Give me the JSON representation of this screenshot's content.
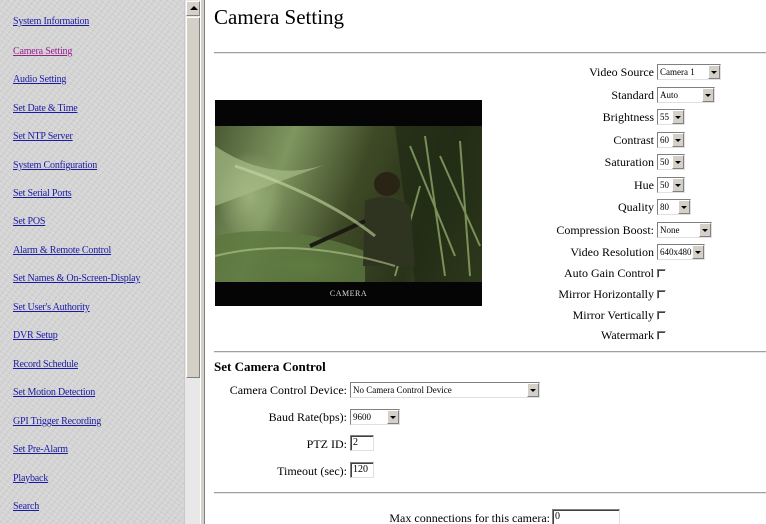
{
  "nav": {
    "items": [
      {
        "label": "System Information",
        "active": false
      },
      {
        "label": "Camera Setting",
        "active": true
      },
      {
        "label": "Audio Setting",
        "active": false
      },
      {
        "label": "Set Date & Time",
        "active": false
      },
      {
        "label": "Set NTP Server",
        "active": false
      },
      {
        "label": "System Configuration",
        "active": false
      },
      {
        "label": "Set Serial Ports",
        "active": false
      },
      {
        "label": "Set POS",
        "active": false
      },
      {
        "label": "Alarm & Remote Control",
        "active": false
      },
      {
        "label": "Set Names & On-Screen-Display",
        "active": false
      },
      {
        "label": "Set User's Authority",
        "active": false
      },
      {
        "label": "DVR Setup",
        "active": false
      },
      {
        "label": "Record Schedule",
        "active": false
      },
      {
        "label": "Set Motion Detection",
        "active": false
      },
      {
        "label": "GPI Trigger Recording",
        "active": false
      },
      {
        "label": "Set Pre-Alarm",
        "active": false
      },
      {
        "label": "Playback",
        "active": false
      },
      {
        "label": "Search",
        "active": false
      }
    ],
    "link_color": "#1a1aa6",
    "active_color": "#9a1f8f"
  },
  "page": {
    "title": "Camera Setting"
  },
  "preview": {
    "caption": "CAMERA"
  },
  "camera": {
    "video_source": {
      "label": "Video Source",
      "value": "Camera 1"
    },
    "standard": {
      "label": "Standard",
      "value": "Auto"
    },
    "brightness": {
      "label": "Brightness",
      "value": "55"
    },
    "contrast": {
      "label": "Contrast",
      "value": "60"
    },
    "saturation": {
      "label": "Saturation",
      "value": "50"
    },
    "hue": {
      "label": "Hue",
      "value": "50"
    },
    "quality": {
      "label": "Quality",
      "value": "80"
    },
    "compression_boost": {
      "label": "Compression Boost:",
      "value": "None"
    },
    "video_resolution": {
      "label": "Video Resolution",
      "value": "640x480"
    },
    "auto_gain_control": {
      "label": "Auto Gain Control",
      "checked": false
    },
    "mirror_horizontally": {
      "label": "Mirror Horizontally",
      "checked": false
    },
    "mirror_vertically": {
      "label": "Mirror Vertically",
      "checked": false
    },
    "watermark": {
      "label": "Watermark",
      "checked": false
    }
  },
  "camera_control": {
    "section_title": "Set Camera Control",
    "device": {
      "label": "Camera Control Device:",
      "value": "No Camera Control Device"
    },
    "baud_rate": {
      "label": "Baud Rate(bps):",
      "value": "9600"
    },
    "ptz_id": {
      "label": "PTZ ID:",
      "value": "2"
    },
    "timeout": {
      "label": "Timeout (sec):",
      "value": "120"
    }
  },
  "connections": {
    "label": "Max connections for this camera:",
    "value": "0"
  }
}
